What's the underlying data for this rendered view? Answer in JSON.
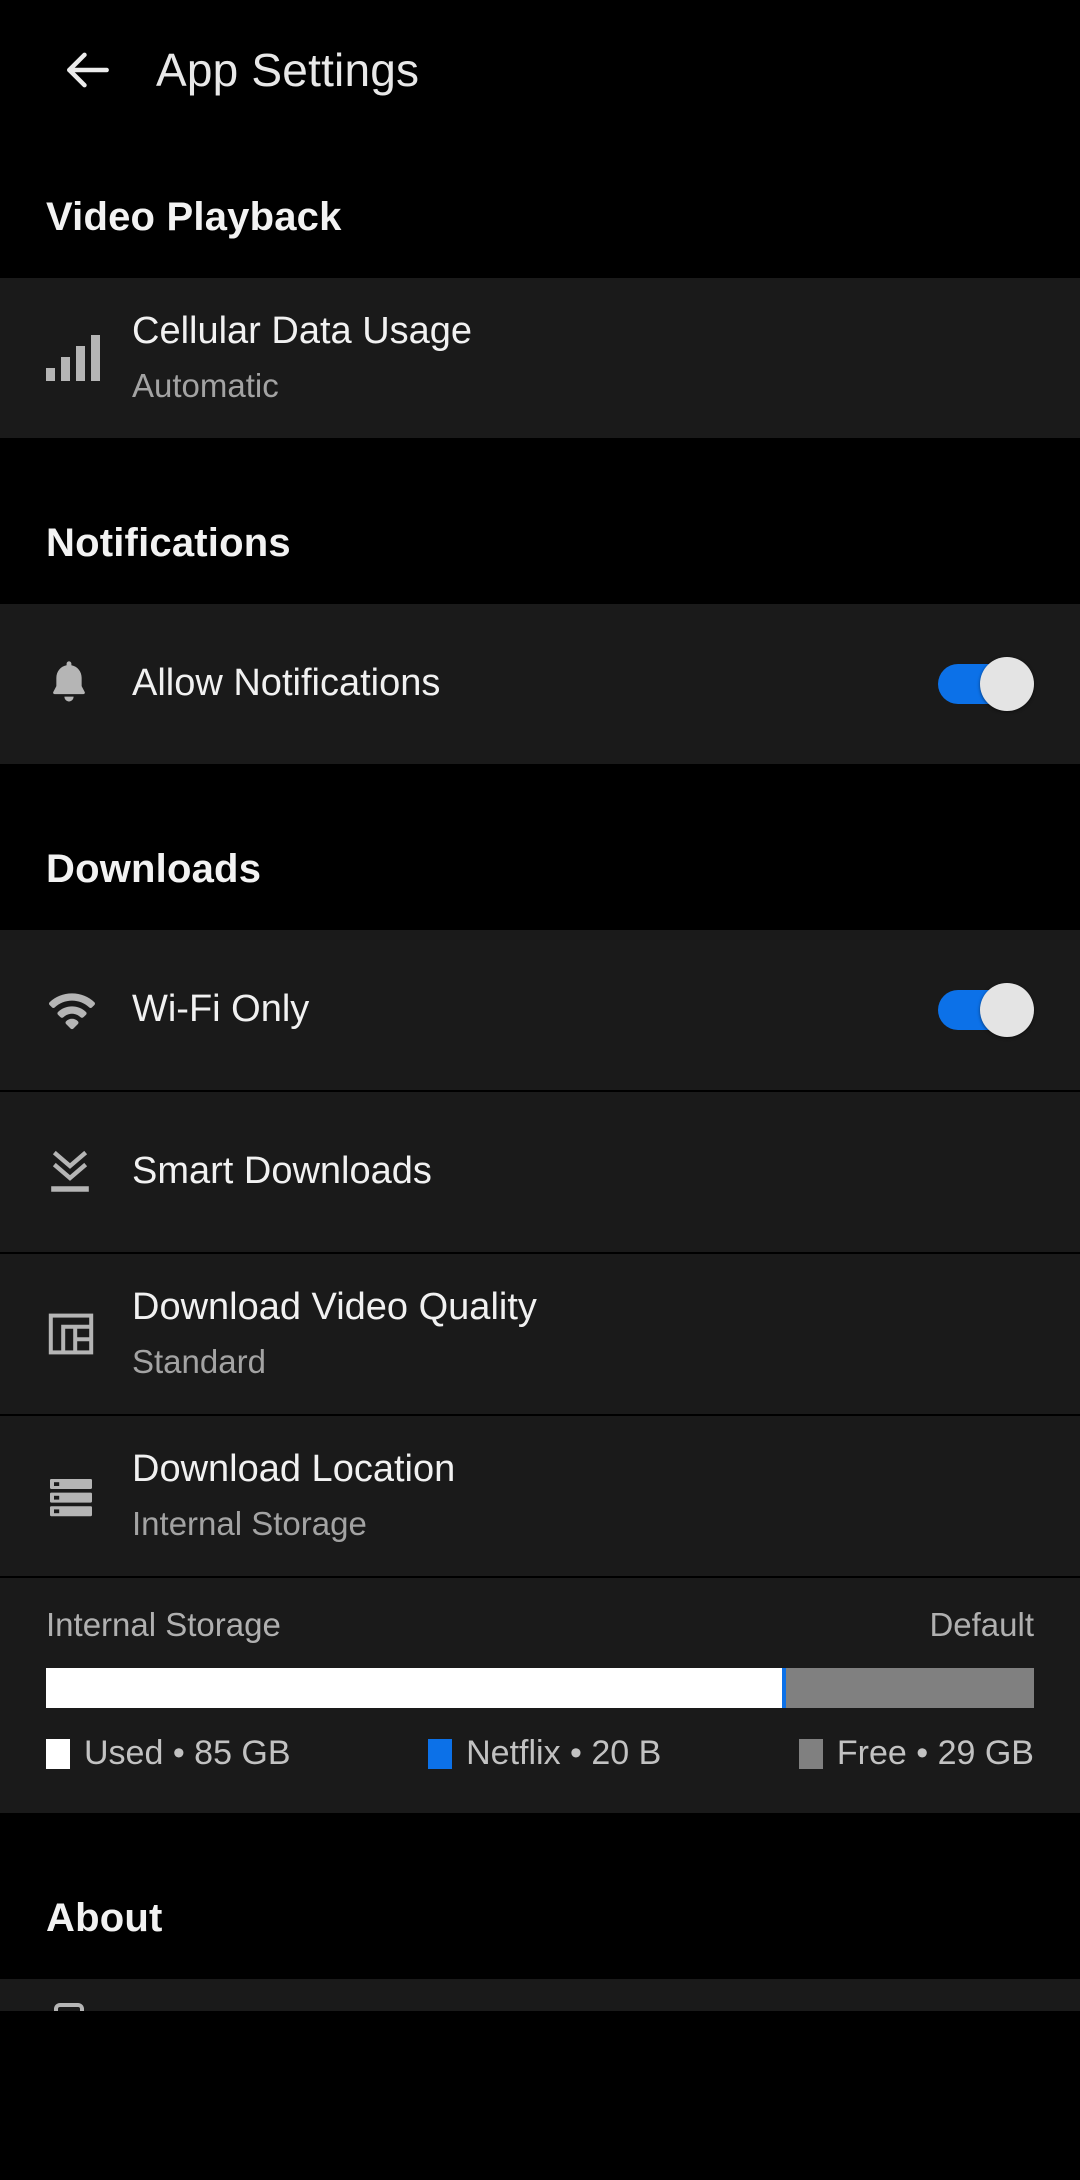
{
  "header": {
    "back_icon": "arrow-left-icon",
    "title": "App Settings"
  },
  "sections": {
    "video_playback": {
      "header": "Video Playback",
      "rows": [
        {
          "icon": "signal-bars-icon",
          "title": "Cellular Data Usage",
          "subtitle": "Automatic"
        }
      ]
    },
    "notifications": {
      "header": "Notifications",
      "rows": [
        {
          "icon": "bell-icon",
          "title": "Allow Notifications",
          "toggle_state": "on"
        }
      ]
    },
    "downloads": {
      "header": "Downloads",
      "rows": [
        {
          "icon": "wifi-icon",
          "title": "Wi-Fi Only",
          "toggle_state": "on"
        },
        {
          "icon": "double-chevron-down-icon",
          "title": "Smart Downloads"
        },
        {
          "icon": "video-quality-icon",
          "title": "Download Video Quality",
          "subtitle": "Standard"
        },
        {
          "icon": "storage-stack-icon",
          "title": "Download Location",
          "subtitle": "Internal Storage"
        }
      ],
      "storage": {
        "label": "Internal Storage",
        "badge": "Default",
        "legend": [
          {
            "name": "Used",
            "value": "85 GB",
            "text": "Used • 85 GB",
            "color": "#ffffff",
            "percent": 74.5
          },
          {
            "name": "Netflix",
            "value": "20 B",
            "text": "Netflix • 20 B",
            "color": "#0c71e8",
            "percent": 0.2
          },
          {
            "name": "Free",
            "value": "29 GB",
            "text": "Free • 29 GB",
            "color": "#808080",
            "percent": 25.3
          }
        ]
      }
    },
    "about": {
      "header": "About"
    }
  },
  "colors": {
    "background": "#000000",
    "card": "#1a1a1a",
    "accent_blue": "#0c71e8",
    "text_primary": "#f1f1f1",
    "text_secondary": "#a3a3a3",
    "toggle_knob": "#e4e4e4",
    "storage_free": "#808080",
    "storage_used": "#ffffff"
  }
}
